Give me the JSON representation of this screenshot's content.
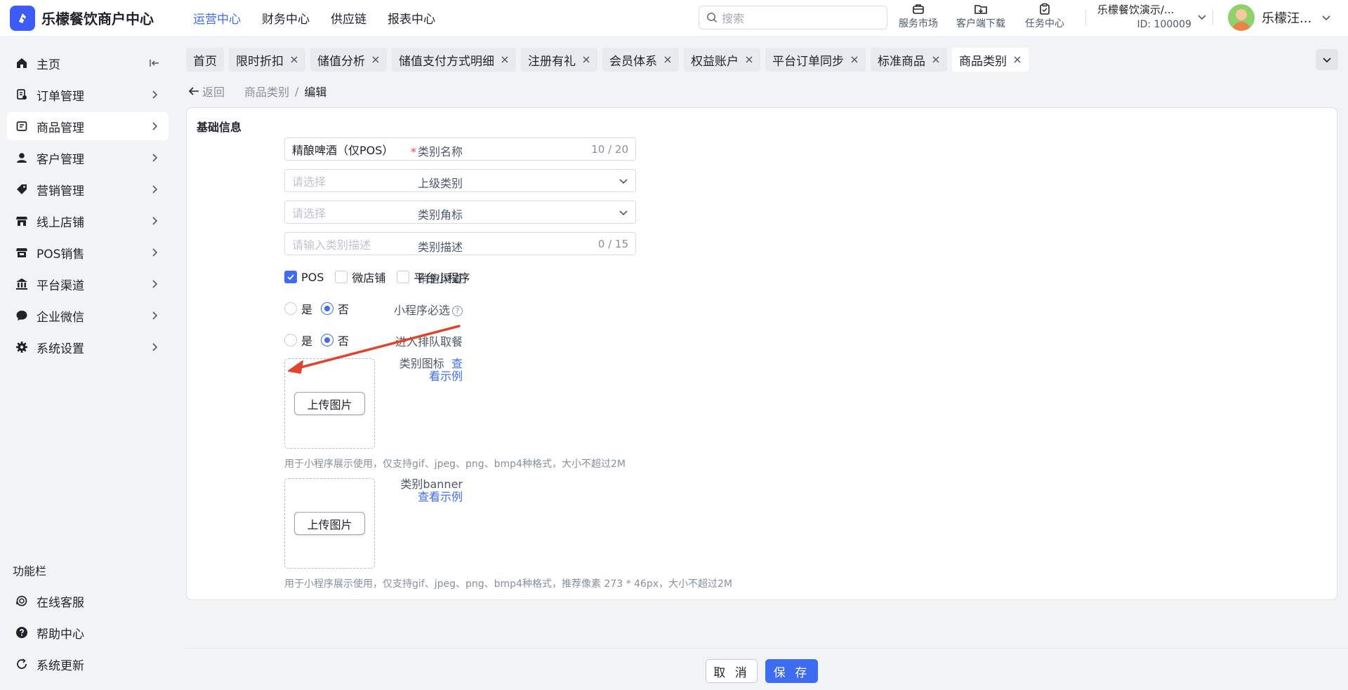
{
  "header": {
    "brand_name": "乐檬餐饮商户中心",
    "brand_mark": "✦",
    "nav": [
      "运营中心",
      "财务中心",
      "供应链",
      "报表中心"
    ],
    "active_nav_index": 0,
    "search_placeholder": "搜索",
    "tools": [
      "服务市场",
      "客户端下载",
      "任务中心"
    ],
    "store_name": "乐檬餐饮演示/...",
    "store_id": "ID: 100009",
    "user_name": "乐檬汪..."
  },
  "sidebar": {
    "items": [
      {
        "label": "主页",
        "icon": "home-icon"
      },
      {
        "label": "订单管理",
        "icon": "order-icon"
      },
      {
        "label": "商品管理",
        "icon": "goods-icon"
      },
      {
        "label": "客户管理",
        "icon": "customer-icon"
      },
      {
        "label": "营销管理",
        "icon": "tag-icon"
      },
      {
        "label": "线上店铺",
        "icon": "store-icon"
      },
      {
        "label": "POS销售",
        "icon": "pos-icon"
      },
      {
        "label": "平台渠道",
        "icon": "bank-icon"
      },
      {
        "label": "企业微信",
        "icon": "chat-icon"
      },
      {
        "label": "系统设置",
        "icon": "gear-icon"
      }
    ],
    "active_index": 2,
    "section_title": "功能栏",
    "bottom_items": [
      {
        "label": "在线客服",
        "icon": "headset-icon"
      },
      {
        "label": "帮助中心",
        "icon": "help-icon"
      },
      {
        "label": "系统更新",
        "icon": "refresh-icon"
      }
    ]
  },
  "tabs": [
    {
      "label": "首页",
      "closable": false
    },
    {
      "label": "限时折扣",
      "closable": true
    },
    {
      "label": "储值分析",
      "closable": true
    },
    {
      "label": "储值支付方式明细",
      "closable": true
    },
    {
      "label": "注册有礼",
      "closable": true
    },
    {
      "label": "会员体系",
      "closable": true
    },
    {
      "label": "权益账户",
      "closable": true
    },
    {
      "label": "平台订单同步",
      "closable": true
    },
    {
      "label": "标准商品",
      "closable": true
    },
    {
      "label": "商品类别",
      "closable": true
    }
  ],
  "active_tab_index": 9,
  "breadcrumb": {
    "back": "返回",
    "parent": "商品类别",
    "separator": "/",
    "current": "编辑"
  },
  "form": {
    "section_title": "基础信息",
    "name": {
      "label": "类别名称",
      "value": "精酿啤酒（仅POS）",
      "count": "10 / 20"
    },
    "parent": {
      "label": "上级类别",
      "placeholder": "请选择"
    },
    "corner": {
      "label": "类别角标",
      "placeholder": "请选择"
    },
    "desc": {
      "label": "类别描述",
      "placeholder": "请输入类别描述",
      "count": "0 / 15"
    },
    "channels": {
      "label": "销售渠道",
      "options": [
        {
          "label": "POS",
          "checked": true
        },
        {
          "label": "微店铺",
          "checked": false
        },
        {
          "label": "平台小程序",
          "checked": false
        }
      ]
    },
    "mini_required": {
      "label": "小程序必选",
      "help": "?",
      "yes": "是",
      "no": "否",
      "value": "否"
    },
    "queue": {
      "label": "进入排队取餐",
      "yes": "是",
      "no": "否",
      "value": "否"
    },
    "icon_upload": {
      "label": "类别图标",
      "example_link_line1": "查",
      "example_link_line2": "看示例",
      "button": "上传图片",
      "hint": "用于小程序展示使用，仅支持gif、jpeg、png、bmp4种格式，大小不超过2M"
    },
    "banner_upload": {
      "label": "类别banner",
      "example_link": "查看示例",
      "button": "上传图片",
      "hint": "用于小程序展示使用，仅支持gif、jpeg、png、bmp4种格式，推荐像素 273 * 46px，大小不超过2M"
    }
  },
  "footer": {
    "cancel": "取 消",
    "save": "保 存"
  },
  "colors": {
    "accent": "#3d6cf0",
    "annotation_arrow": "#e0442e",
    "required": "#f53f3f"
  }
}
